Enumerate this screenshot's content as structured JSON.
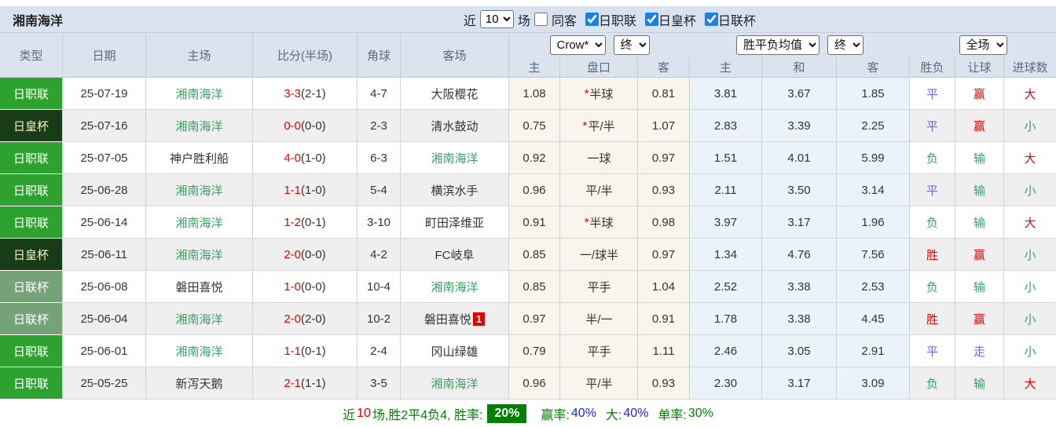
{
  "topbar": {
    "title": "湘南海洋",
    "recent_label": "近",
    "recent_count": "10",
    "matches_label": "场",
    "same_opponent_label": "同客",
    "filters": [
      {
        "label": "日职联",
        "checked": true
      },
      {
        "label": "日皇杯",
        "checked": true
      },
      {
        "label": "日联杯",
        "checked": true
      }
    ]
  },
  "header": {
    "columns": [
      "类型",
      "日期",
      "主场",
      "比分(半场)",
      "角球",
      "客场"
    ],
    "bookmaker_select": "Crow*",
    "asian_time_select": "终",
    "europe_select": "胜平负均值",
    "europe_time_select": "终",
    "scope_select": "全场",
    "sub_columns": [
      "主",
      "盘口",
      "客",
      "主",
      "和",
      "客",
      "胜负",
      "让球",
      "进球数"
    ]
  },
  "colors": {
    "league_green": "#2ea22e",
    "emperor_cup_dark_green": "#173c17",
    "league_cup_sage": "#76a278",
    "team_highlight_green": "#3a9e64",
    "win_red": "#e60000",
    "draw_blue": "#6666ff",
    "footer_badge_green": "#008000"
  },
  "rows": [
    {
      "type": "日职联",
      "type_class": "type-jl",
      "date": "25-07-19",
      "home": "湘南海洋",
      "home_class": "t-green",
      "score": "3-3",
      "half": "(2-1)",
      "corner": "4-7",
      "away": "大阪樱花",
      "away_class": "",
      "away_badge": "",
      "asia_home": "1.08",
      "handicap_star": "*",
      "handicap": "半球",
      "asia_away": "0.81",
      "odds_home": "3.81",
      "odds_draw": "3.67",
      "odds_away": "1.85",
      "result": "平",
      "result_class": "c-blue",
      "handicap_result": "赢",
      "handicap_result_class": "c-red",
      "goals": "大",
      "goals_class": "c-red"
    },
    {
      "type": "日皇杯",
      "type_class": "type-emp",
      "date": "25-07-16",
      "home": "湘南海洋",
      "home_class": "t-green",
      "score": "0-0",
      "half": "(0-0)",
      "corner": "2-3",
      "away": "清水鼓动",
      "away_class": "",
      "away_badge": "",
      "asia_home": "0.75",
      "handicap_star": "*",
      "handicap": "平/半",
      "asia_away": "1.07",
      "odds_home": "2.83",
      "odds_draw": "3.39",
      "odds_away": "2.25",
      "result": "平",
      "result_class": "c-blue",
      "handicap_result": "赢",
      "handicap_result_class": "c-red",
      "goals": "小",
      "goals_class": "c-green"
    },
    {
      "type": "日职联",
      "type_class": "type-jl",
      "date": "25-07-05",
      "home": "神户胜利船",
      "home_class": "",
      "score": "4-0",
      "half": "(1-0)",
      "corner": "6-3",
      "away": "湘南海洋",
      "away_class": "t-green",
      "away_badge": "",
      "asia_home": "0.92",
      "handicap_star": "",
      "handicap": "一球",
      "asia_away": "0.97",
      "odds_home": "1.51",
      "odds_draw": "4.01",
      "odds_away": "5.99",
      "result": "负",
      "result_class": "c-green",
      "handicap_result": "输",
      "handicap_result_class": "c-green",
      "goals": "大",
      "goals_class": "c-red"
    },
    {
      "type": "日职联",
      "type_class": "type-jl",
      "date": "25-06-28",
      "home": "湘南海洋",
      "home_class": "t-green",
      "score": "1-1",
      "half": "(1-0)",
      "corner": "5-4",
      "away": "横滨水手",
      "away_class": "",
      "away_badge": "",
      "asia_home": "0.96",
      "handicap_star": "",
      "handicap": "平/半",
      "asia_away": "0.93",
      "odds_home": "2.11",
      "odds_draw": "3.50",
      "odds_away": "3.14",
      "result": "平",
      "result_class": "c-blue",
      "handicap_result": "输",
      "handicap_result_class": "c-green",
      "goals": "小",
      "goals_class": "c-green"
    },
    {
      "type": "日职联",
      "type_class": "type-jl",
      "date": "25-06-14",
      "home": "湘南海洋",
      "home_class": "t-green",
      "score": "1-2",
      "half": "(0-1)",
      "corner": "3-10",
      "away": "町田泽维亚",
      "away_class": "",
      "away_badge": "",
      "asia_home": "0.91",
      "handicap_star": "*",
      "handicap": "半球",
      "asia_away": "0.98",
      "odds_home": "3.97",
      "odds_draw": "3.17",
      "odds_away": "1.96",
      "result": "负",
      "result_class": "c-green",
      "handicap_result": "输",
      "handicap_result_class": "c-green",
      "goals": "大",
      "goals_class": "c-red"
    },
    {
      "type": "日皇杯",
      "type_class": "type-emp",
      "date": "25-06-11",
      "home": "湘南海洋",
      "home_class": "t-green",
      "score": "2-0",
      "half": "(0-0)",
      "corner": "4-2",
      "away": "FC岐阜",
      "away_class": "",
      "away_badge": "",
      "asia_home": "0.85",
      "handicap_star": "",
      "handicap": "一/球半",
      "asia_away": "0.97",
      "odds_home": "1.34",
      "odds_draw": "4.76",
      "odds_away": "7.56",
      "result": "胜",
      "result_class": "c-red",
      "handicap_result": "赢",
      "handicap_result_class": "c-red",
      "goals": "小",
      "goals_class": "c-green"
    },
    {
      "type": "日联杯",
      "type_class": "type-cup",
      "date": "25-06-08",
      "home": "磐田喜悦",
      "home_class": "",
      "score": "1-0",
      "half": "(0-0)",
      "corner": "10-4",
      "away": "湘南海洋",
      "away_class": "t-green",
      "away_badge": "",
      "asia_home": "0.85",
      "handicap_star": "",
      "handicap": "平手",
      "asia_away": "1.04",
      "odds_home": "2.52",
      "odds_draw": "3.38",
      "odds_away": "2.53",
      "result": "负",
      "result_class": "c-green",
      "handicap_result": "输",
      "handicap_result_class": "c-green",
      "goals": "小",
      "goals_class": "c-green"
    },
    {
      "type": "日联杯",
      "type_class": "type-cup",
      "date": "25-06-04",
      "home": "湘南海洋",
      "home_class": "t-green",
      "score": "2-0",
      "half": "(2-0)",
      "corner": "10-2",
      "away": "磐田喜悦",
      "away_class": "",
      "away_badge": "1",
      "asia_home": "0.97",
      "handicap_star": "",
      "handicap": "半/一",
      "asia_away": "0.91",
      "odds_home": "1.78",
      "odds_draw": "3.38",
      "odds_away": "4.45",
      "result": "胜",
      "result_class": "c-red",
      "handicap_result": "赢",
      "handicap_result_class": "c-red",
      "goals": "小",
      "goals_class": "c-green"
    },
    {
      "type": "日职联",
      "type_class": "type-jl",
      "date": "25-06-01",
      "home": "湘南海洋",
      "home_class": "t-green",
      "score": "1-1",
      "half": "(0-1)",
      "corner": "2-4",
      "away": "冈山绿雄",
      "away_class": "",
      "away_badge": "",
      "asia_home": "0.79",
      "handicap_star": "",
      "handicap": "平手",
      "asia_away": "1.11",
      "odds_home": "2.46",
      "odds_draw": "3.05",
      "odds_away": "2.91",
      "result": "平",
      "result_class": "c-blue",
      "handicap_result": "走",
      "handicap_result_class": "c-blue",
      "goals": "小",
      "goals_class": "c-green"
    },
    {
      "type": "日职联",
      "type_class": "type-jl",
      "date": "25-05-25",
      "home": "新泻天鹅",
      "home_class": "",
      "score": "2-1",
      "half": "(1-1)",
      "corner": "3-5",
      "away": "湘南海洋",
      "away_class": "t-green",
      "away_badge": "",
      "asia_home": "0.96",
      "handicap_star": "",
      "handicap": "平/半",
      "asia_away": "0.93",
      "odds_home": "2.30",
      "odds_draw": "3.17",
      "odds_away": "3.09",
      "result": "负",
      "result_class": "c-green",
      "handicap_result": "输",
      "handicap_result_class": "c-green",
      "goals": "大",
      "goals_class": "c-red"
    }
  ],
  "footer": {
    "prefix": "近",
    "count": "10",
    "summary": "场,胜2平4负4, 胜率:",
    "win_rate": "20%",
    "handicap_label": "赢率:",
    "handicap_rate": "40%",
    "big_label": "大:",
    "big_rate": "40%",
    "odd_label": "单率:",
    "odd_rate": "30%"
  }
}
